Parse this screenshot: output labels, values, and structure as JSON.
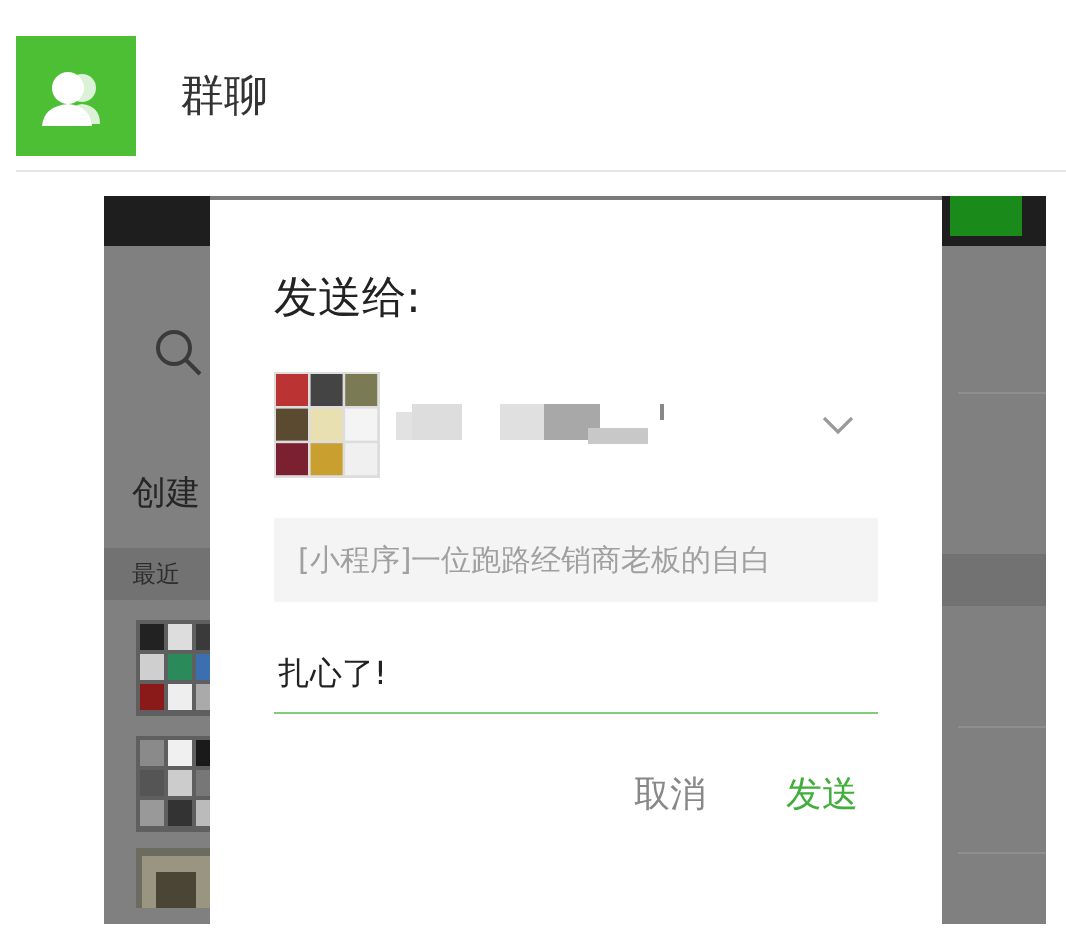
{
  "header": {
    "title": "群聊"
  },
  "background": {
    "create_label": "创建",
    "section_label": "最近"
  },
  "dialog": {
    "title": "发送给:",
    "preview": "[小程序]一位跑路经销商老板的自白",
    "message": "扎心了!",
    "buttons": [
      {
        "label": "取消",
        "kind": "cancel"
      },
      {
        "label": "发送",
        "kind": "confirm"
      }
    ]
  }
}
